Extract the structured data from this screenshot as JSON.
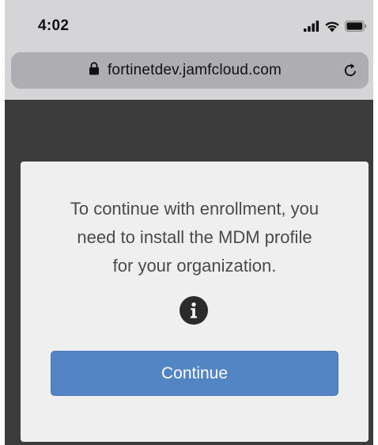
{
  "status_bar": {
    "time": "4:02",
    "icons": [
      "cellular-signal-icon",
      "wifi-icon",
      "battery-icon"
    ]
  },
  "browser": {
    "url": "fortinetdev.jamfcloud.com",
    "secure_icon": "lock-icon",
    "reload_icon": "reload-icon"
  },
  "dialog": {
    "message_lines": [
      "To continue with enrollment, you",
      "need to install the MDM profile",
      "for your organization."
    ],
    "info_icon": "info-icon",
    "continue_label": "Continue"
  },
  "colors": {
    "chrome_background": "#d5d5d7",
    "url_bar": "#aeaeb2",
    "page_background": "#3c3c3c",
    "card_background": "#efefef",
    "button_primary": "#5384c4",
    "message_text": "#4a4a4a"
  }
}
